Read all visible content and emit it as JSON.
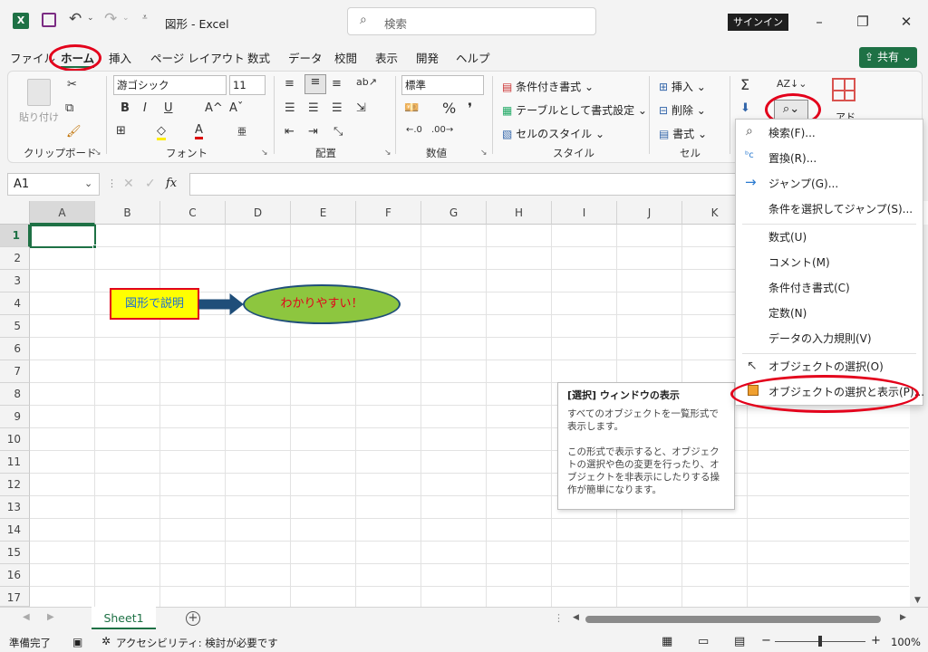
{
  "titlebar": {
    "title": "図形 - Excel",
    "search_placeholder": "検索",
    "signin_label": "サインイン"
  },
  "menu": {
    "items": [
      "ファイル",
      "ホーム",
      "挿入",
      "ページ レイアウト",
      "数式",
      "データ",
      "校閲",
      "表示",
      "開発",
      "ヘルプ"
    ],
    "share_label": "共有"
  },
  "ribbon": {
    "clipboard": {
      "paste_label": "貼り付け",
      "group_label": "クリップボード"
    },
    "font": {
      "font_name": "游ゴシック",
      "font_size": "11",
      "group_label": "フォント"
    },
    "alignment": {
      "group_label": "配置"
    },
    "number": {
      "format": "標準",
      "group_label": "数値"
    },
    "styles": {
      "conditional": "条件付き書式",
      "table": "テーブルとして書式設定",
      "cell_style": "セルのスタイル",
      "group_label": "スタイル"
    },
    "cells": {
      "insert": "挿入",
      "delete": "削除",
      "format": "書式",
      "group_label": "セル"
    },
    "addin_label": "アド"
  },
  "formula": {
    "namebox": "A1",
    "fx": "fx"
  },
  "grid": {
    "columns": [
      "A",
      "B",
      "C",
      "D",
      "E",
      "F",
      "G",
      "H",
      "I",
      "J",
      "K"
    ],
    "rows": [
      "1",
      "2",
      "3",
      "4",
      "5",
      "6",
      "7",
      "8",
      "9",
      "10",
      "11",
      "12",
      "13",
      "14",
      "15",
      "16",
      "17"
    ]
  },
  "shapes": {
    "box_text": "図形で説明",
    "oval_text": "わかりやすい！"
  },
  "dropdown": {
    "items": [
      "検索(F)...",
      "置換(R)...",
      "ジャンプ(G)...",
      "条件を選択してジャンプ(S)...",
      "数式(U)",
      "コメント(M)",
      "条件付き書式(C)",
      "定数(N)",
      "データの入力規則(V)",
      "オブジェクトの選択(O)",
      "オブジェクトの選択と表示(P)..."
    ]
  },
  "tooltip": {
    "title": "[選択] ウィンドウの表示",
    "line1": "すべてのオブジェクトを一覧形式で表示します。",
    "line2": "この形式で表示すると、オブジェクトの選択や色の変更を行ったり、オブジェクトを非表示にしたりする操作が簡単になります。"
  },
  "sheet": {
    "tab": "Sheet1"
  },
  "status": {
    "ready": "準備完了",
    "accessibility": "アクセシビリティ: 検討が必要です",
    "zoom": "100%"
  },
  "colors": {
    "excel_green": "#1e7145",
    "annotation_red": "#e3001b",
    "oval_fill": "#8dc63f",
    "box_fill": "#ffff00"
  }
}
